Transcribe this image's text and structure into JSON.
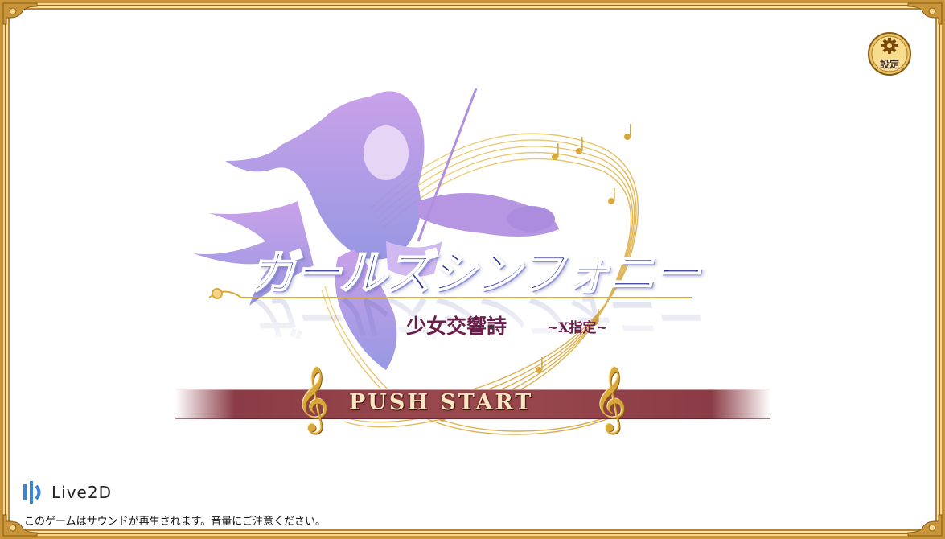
{
  "settings": {
    "label": "設定",
    "icon": "gear-icon"
  },
  "logo": {
    "title": "ガールズシンフォニー",
    "subtitle": "少女交響詩",
    "subtitle_tag": "~X指定~"
  },
  "start": {
    "label": "PUSH START"
  },
  "footer": {
    "brand": "Live2D",
    "notice": "このゲームはサウンドが再生されます。音量にご注意ください。"
  },
  "colors": {
    "frame_gold": "#c8953a",
    "title_blue": "#2a2f93",
    "start_bar": "#9a4a4e",
    "subtitle": "#6a1e4a",
    "girl_lavender": "#c59ae8"
  }
}
